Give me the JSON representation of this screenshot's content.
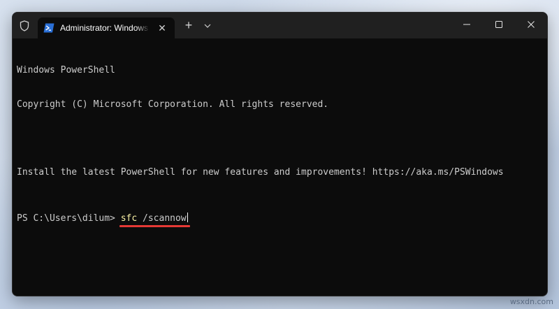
{
  "window": {
    "tab_title": "Administrator: Windows PowerShell",
    "new_tab_symbol": "+",
    "dropdown_symbol": "⌄",
    "close_tab_symbol": "✕"
  },
  "icons": {
    "admin": "shield-icon",
    "tab": "powershell-icon",
    "minimize": "minimize-icon",
    "maximize": "maximize-icon",
    "close": "close-icon"
  },
  "terminal": {
    "lines": [
      "Windows PowerShell",
      "Copyright (C) Microsoft Corporation. All rights reserved.",
      "",
      "Install the latest PowerShell for new features and improvements! https://aka.ms/PSWindows"
    ],
    "prompt": "PS C:\\Users\\dilum> ",
    "command": "sfc",
    "command_arg": " /scannow"
  },
  "colors": {
    "terminal_bg": "#0c0c0c",
    "titlebar_bg": "#202020",
    "text": "#cccccc",
    "command": "#f9f1a5",
    "highlight_underline": "#e53935"
  },
  "watermark": "wsxdn.com"
}
